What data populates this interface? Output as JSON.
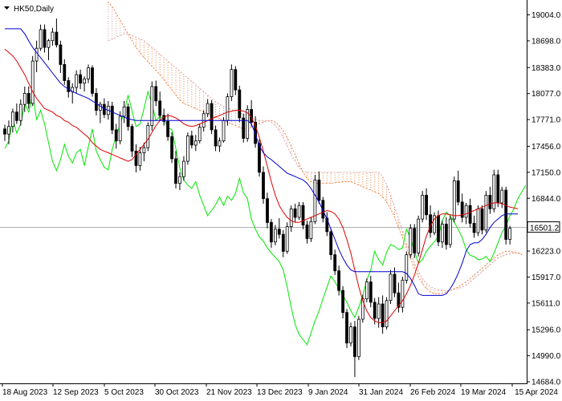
{
  "header": {
    "symbol_label": "HK50,Daily"
  },
  "colors": {
    "bull_candle": "#000000",
    "bear_candle": "#000000",
    "chikou": "#00e600",
    "tenkan": "#e00000",
    "kijun": "#0000d0",
    "cloud_bull_edge": "#d9a0a0",
    "cloud_bear_edge": "#f08040",
    "current_line": "#808080"
  },
  "chart_data": {
    "type": "candlestick",
    "indicator": "Ichimoku",
    "ylim": [
      14684,
      19160
    ],
    "y_ticks": [
      "19004.0",
      "18698.0",
      "18383.0",
      "18077.0",
      "17771.0",
      "17456.0",
      "17150.0",
      "16844.0",
      "16223.0",
      "15917.0",
      "15611.0",
      "15296.0",
      "14990.0",
      "14684.0"
    ],
    "x_ticks": [
      "18 Aug 2023",
      "12 Sep 2023",
      "5 Oct 2023",
      "30 Oct 2023",
      "21 Nov 2023",
      "13 Dec 2023",
      "9 Jan 2024",
      "31 Jan 2024",
      "26 Feb 2024",
      "19 Mar 2024",
      "15 Apr 2024"
    ],
    "current_price": "16501.2",
    "candles": [
      [
        17660,
        17710,
        17520,
        17600
      ],
      [
        17600,
        17760,
        17480,
        17690
      ],
      [
        17690,
        17900,
        17620,
        17860
      ],
      [
        17860,
        17960,
        17720,
        17760
      ],
      [
        17760,
        18010,
        17700,
        17950
      ],
      [
        17950,
        18160,
        17860,
        18080
      ],
      [
        18080,
        18160,
        17900,
        17960
      ],
      [
        17960,
        18520,
        17930,
        18460
      ],
      [
        18460,
        18700,
        18330,
        18610
      ],
      [
        18610,
        18890,
        18580,
        18830
      ],
      [
        18830,
        18890,
        18560,
        18620
      ],
      [
        18620,
        18720,
        18470,
        18700
      ],
      [
        18700,
        18850,
        18640,
        18800
      ],
      [
        18800,
        18960,
        18620,
        18650
      ],
      [
        18650,
        18700,
        18320,
        18420
      ],
      [
        18420,
        18480,
        18180,
        18230
      ],
      [
        18230,
        18270,
        18030,
        18100
      ],
      [
        18100,
        18200,
        17960,
        18150
      ],
      [
        18150,
        18350,
        18080,
        18300
      ],
      [
        18300,
        18360,
        18130,
        18200
      ],
      [
        18200,
        18280,
        18100,
        18250
      ],
      [
        18250,
        18420,
        18200,
        18380
      ],
      [
        18380,
        18410,
        18040,
        18080
      ],
      [
        18080,
        18140,
        17820,
        17880
      ],
      [
        17880,
        17980,
        17730,
        17950
      ],
      [
        17950,
        18020,
        17790,
        17830
      ],
      [
        17830,
        17990,
        17770,
        17930
      ],
      [
        17930,
        17980,
        17600,
        17650
      ],
      [
        17650,
        17720,
        17430,
        17520
      ],
      [
        17520,
        17870,
        17480,
        17810
      ],
      [
        17810,
        17990,
        17730,
        17920
      ],
      [
        17920,
        17960,
        17640,
        17690
      ],
      [
        17690,
        17720,
        17330,
        17400
      ],
      [
        17400,
        17480,
        17150,
        17230
      ],
      [
        17230,
        17450,
        17170,
        17380
      ],
      [
        17380,
        17500,
        17280,
        17440
      ],
      [
        17440,
        17740,
        17400,
        17700
      ],
      [
        17700,
        18220,
        17640,
        18160
      ],
      [
        18160,
        18230,
        17930,
        17990
      ],
      [
        17990,
        18100,
        17760,
        17820
      ],
      [
        17820,
        17900,
        17700,
        17750
      ],
      [
        17750,
        17840,
        17520,
        17570
      ],
      [
        17570,
        17620,
        17260,
        17310
      ],
      [
        17310,
        17400,
        16960,
        17020
      ],
      [
        17020,
        17150,
        16940,
        17100
      ],
      [
        17100,
        17340,
        17050,
        17280
      ],
      [
        17280,
        17620,
        17240,
        17580
      ],
      [
        17580,
        17640,
        17430,
        17470
      ],
      [
        17470,
        17590,
        17400,
        17520
      ],
      [
        17520,
        17720,
        17490,
        17680
      ],
      [
        17680,
        17880,
        17630,
        17840
      ],
      [
        17840,
        18010,
        17800,
        17960
      ],
      [
        17960,
        18000,
        17600,
        17650
      ],
      [
        17650,
        17700,
        17400,
        17460
      ],
      [
        17460,
        17560,
        17390,
        17520
      ],
      [
        17520,
        17800,
        17500,
        17760
      ],
      [
        17760,
        18080,
        17700,
        18040
      ],
      [
        18040,
        18420,
        17990,
        18360
      ],
      [
        18360,
        18400,
        18060,
        18120
      ],
      [
        18120,
        18170,
        17740,
        17790
      ],
      [
        17790,
        17840,
        17500,
        17550
      ],
      [
        17550,
        17940,
        17510,
        17890
      ],
      [
        17890,
        18000,
        17690,
        17740
      ],
      [
        17740,
        17810,
        17440,
        17490
      ],
      [
        17490,
        17540,
        17100,
        17150
      ],
      [
        17150,
        17220,
        16780,
        16840
      ],
      [
        16840,
        16910,
        16490,
        16560
      ],
      [
        16560,
        16600,
        16260,
        16330
      ],
      [
        16330,
        16530,
        16290,
        16480
      ],
      [
        16480,
        16610,
        16370,
        16420
      ],
      [
        16420,
        16470,
        16150,
        16220
      ],
      [
        16220,
        16560,
        16190,
        16510
      ],
      [
        16510,
        16760,
        16450,
        16720
      ],
      [
        16720,
        16780,
        16560,
        16620
      ],
      [
        16620,
        16800,
        16590,
        16760
      ],
      [
        16760,
        16800,
        16480,
        16530
      ],
      [
        16530,
        16580,
        16310,
        16370
      ],
      [
        16370,
        16620,
        16330,
        16570
      ],
      [
        16570,
        17120,
        16540,
        17060
      ],
      [
        17060,
        17160,
        16780,
        16820
      ],
      [
        16820,
        16860,
        16560,
        16610
      ],
      [
        16610,
        16680,
        16400,
        16450
      ],
      [
        16450,
        16490,
        16120,
        16180
      ],
      [
        16180,
        16240,
        15940,
        15990
      ],
      [
        15990,
        16050,
        15700,
        15760
      ],
      [
        15760,
        15810,
        15430,
        15500
      ],
      [
        15500,
        15540,
        15080,
        15140
      ],
      [
        15140,
        15380,
        15100,
        15330
      ],
      [
        15330,
        15400,
        14740,
        14980
      ],
      [
        14980,
        15460,
        14940,
        15420
      ],
      [
        15420,
        15710,
        15380,
        15660
      ],
      [
        15660,
        15900,
        15620,
        15860
      ],
      [
        15860,
        15930,
        15560,
        15620
      ],
      [
        15620,
        15670,
        15360,
        15430
      ],
      [
        15430,
        15680,
        15320,
        15600
      ],
      [
        15600,
        15700,
        15250,
        15330
      ],
      [
        15330,
        15680,
        15300,
        15640
      ],
      [
        15640,
        16000,
        15600,
        15950
      ],
      [
        15950,
        16030,
        15680,
        15730
      ],
      [
        15730,
        15850,
        15500,
        15560
      ],
      [
        15560,
        15920,
        15500,
        15880
      ],
      [
        15880,
        16220,
        15840,
        16180
      ],
      [
        16180,
        16540,
        16140,
        16490
      ],
      [
        16490,
        16540,
        16140,
        16200
      ],
      [
        16200,
        16640,
        16160,
        16600
      ],
      [
        16600,
        16930,
        16560,
        16880
      ],
      [
        16880,
        16960,
        16590,
        16650
      ],
      [
        16650,
        16760,
        16380,
        16440
      ],
      [
        16440,
        16680,
        16410,
        16640
      ],
      [
        16640,
        16700,
        16280,
        16330
      ],
      [
        16330,
        16580,
        16260,
        16540
      ],
      [
        16540,
        16620,
        16240,
        16300
      ],
      [
        16300,
        16640,
        16260,
        16600
      ],
      [
        16600,
        17100,
        16560,
        17050
      ],
      [
        17050,
        17170,
        16760,
        16800
      ],
      [
        16800,
        16900,
        16560,
        16620
      ],
      [
        16620,
        16790,
        16540,
        16760
      ],
      [
        16760,
        16840,
        16500,
        16550
      ],
      [
        16550,
        16640,
        16380,
        16440
      ],
      [
        16440,
        16760,
        16400,
        16720
      ],
      [
        16720,
        16760,
        16420,
        16470
      ],
      [
        16470,
        16930,
        16440,
        16880
      ],
      [
        16880,
        16980,
        16660,
        16720
      ],
      [
        16720,
        17180,
        16680,
        17120
      ],
      [
        17120,
        17180,
        16740,
        16790
      ],
      [
        16790,
        16980,
        16730,
        16940
      ],
      [
        16940,
        16980,
        16300,
        16360
      ],
      [
        16360,
        16520,
        16300,
        16490
      ]
    ],
    "tenkan": [
      18600,
      18560,
      18520,
      18460,
      18380,
      18300,
      18200,
      18100,
      18020,
      17960,
      17900,
      17880,
      17860,
      17820,
      17800,
      17760,
      17740,
      17700,
      17680,
      17640,
      17600,
      17560,
      17500,
      17460,
      17420,
      17400,
      17380,
      17360,
      17340,
      17320,
      17300,
      17280,
      17300,
      17360,
      17420,
      17480,
      17540,
      17620,
      17700,
      17760,
      17800,
      17820,
      17810,
      17790,
      17760,
      17720,
      17700,
      17690,
      17700,
      17720,
      17740,
      17760,
      17780,
      17800,
      17820,
      17840,
      17860,
      17870,
      17880,
      17880,
      17870,
      17850,
      17800,
      17700,
      17560,
      17400,
      17220,
      17040,
      16880,
      16760,
      16680,
      16620,
      16580,
      16560,
      16560,
      16580,
      16600,
      16620,
      16640,
      16660,
      16680,
      16700,
      16690,
      16660,
      16600,
      16500,
      16360,
      16200,
      16000,
      15800,
      15640,
      15520,
      15440,
      15400,
      15380,
      15380,
      15400,
      15460,
      15520,
      15580,
      15640,
      15720,
      15820,
      15940,
      16080,
      16240,
      16400,
      16520,
      16600,
      16640,
      16660,
      16660,
      16650,
      16640,
      16640,
      16650,
      16660,
      16680,
      16700,
      16720,
      16740,
      16760,
      16780,
      16790,
      16790,
      16780,
      16760,
      16740,
      16730,
      16720
    ],
    "kijun": [
      18840,
      18840,
      18840,
      18840,
      18840,
      18780,
      18700,
      18620,
      18560,
      18500,
      18440,
      18380,
      18320,
      18260,
      18200,
      18160,
      18130,
      18100,
      18080,
      18060,
      18040,
      18020,
      17990,
      17960,
      17930,
      17900,
      17880,
      17860,
      17840,
      17820,
      17800,
      17780,
      17770,
      17760,
      17760,
      17760,
      17760,
      17760,
      17760,
      17760,
      17760,
      17760,
      17760,
      17760,
      17760,
      17760,
      17760,
      17760,
      17760,
      17760,
      17760,
      17760,
      17760,
      17760,
      17760,
      17760,
      17760,
      17760,
      17760,
      17760,
      17760,
      17760,
      17720,
      17600,
      17460,
      17380,
      17330,
      17300,
      17260,
      17220,
      17180,
      17140,
      17120,
      17100,
      17080,
      17060,
      17020,
      16960,
      16880,
      16800,
      16700,
      16600,
      16480,
      16360,
      16240,
      16140,
      16060,
      16000,
      15980,
      15980,
      15980,
      15980,
      15980,
      15980,
      15980,
      15980,
      15980,
      15980,
      15980,
      15980,
      15980,
      15960,
      15900,
      15820,
      15720,
      15700,
      15700,
      15700,
      15700,
      15700,
      15700,
      15720,
      15780,
      15860,
      15960,
      16080,
      16220,
      16300,
      16320,
      16320,
      16360,
      16420,
      16500,
      16560,
      16600,
      16640,
      16660,
      16660,
      16660,
      16660
    ],
    "span_a": [
      null,
      null,
      null,
      null,
      null,
      null,
      null,
      null,
      null,
      null,
      null,
      null,
      null,
      null,
      null,
      null,
      null,
      null,
      null,
      null,
      null,
      null,
      null,
      null,
      null,
      null,
      19160,
      19100,
      19020,
      18940,
      18860,
      18780,
      18700,
      18620,
      18560,
      18500,
      18450,
      18400,
      18350,
      18300,
      18240,
      18180,
      18120,
      18060,
      18000,
      17960,
      17940,
      17920,
      17900,
      17880,
      17860,
      17840,
      17820,
      17800,
      17780,
      17760,
      17740,
      17720,
      17700,
      17680,
      17660,
      17660,
      17680,
      17700,
      17720,
      17740,
      17760,
      17760,
      17740,
      17700,
      17640,
      17560,
      17460,
      17360,
      17250,
      17150,
      17080,
      17040,
      17020,
      17020,
      17020,
      17020,
      17020,
      17030,
      17030,
      17040,
      17040,
      17040,
      17020,
      17000,
      16980,
      16960,
      16940,
      16920,
      16900,
      16860,
      16800,
      16720,
      16620,
      16500,
      16380,
      16260,
      16140,
      16020,
      15920,
      15840,
      15780,
      15740,
      15720,
      15720,
      15720,
      15740,
      15760,
      15780,
      15800,
      15830,
      15860,
      15900,
      15940,
      15980,
      16020,
      16060,
      16100,
      16140,
      16180,
      16200,
      16220,
      16220,
      16210,
      16200,
      16180
    ],
    "span_b": [
      null,
      null,
      null,
      null,
      null,
      null,
      null,
      null,
      null,
      null,
      null,
      null,
      null,
      null,
      null,
      null,
      null,
      null,
      null,
      null,
      null,
      null,
      null,
      null,
      null,
      null,
      18700,
      18720,
      18740,
      18760,
      18780,
      18780,
      18760,
      18740,
      18720,
      18700,
      18660,
      18620,
      18580,
      18540,
      18500,
      18460,
      18420,
      18380,
      18340,
      18300,
      18260,
      18220,
      18180,
      18140,
      18100,
      18060,
      18020,
      17980,
      17950,
      17930,
      17910,
      17890,
      17870,
      17850,
      17830,
      17810,
      17790,
      17770,
      17760,
      17760,
      17760,
      17740,
      17700,
      17640,
      17560,
      17460,
      17360,
      17280,
      17200,
      17160,
      17150,
      17150,
      17150,
      17150,
      17150,
      17150,
      17150,
      17150,
      17150,
      17150,
      17150,
      17150,
      17150,
      17150,
      17150,
      17150,
      17150,
      17150,
      17150,
      17100,
      17000,
      16880,
      16740,
      16600,
      16460,
      16320,
      16200,
      16080,
      15980,
      15900,
      15840,
      15800,
      15780,
      15770,
      15760,
      15760,
      15760,
      15770,
      15780,
      15800,
      15820,
      15860,
      15900,
      15940,
      15980,
      16020,
      16060,
      16100,
      16140,
      16160,
      16180,
      16190,
      16200,
      16200,
      16200
    ],
    "chikou": [
      17430,
      17520,
      17770,
      17610,
      17720,
      17960,
      17860,
      18060,
      17770,
      17880,
      17720,
      17500,
      17280,
      17170,
      17300,
      17480,
      17340,
      17260,
      17380,
      17420,
      17230,
      17450,
      17660,
      17400,
      17300,
      17210,
      17180,
      17420,
      17580,
      17720,
      17850,
      18060,
      17870,
      17690,
      17720,
      17900,
      18100,
      17960,
      17760,
      17810,
      17770,
      17680,
      17650,
      17430,
      17200,
      17060,
      17000,
      16960,
      17040,
      16880,
      16760,
      16640,
      16700,
      16770,
      16860,
      16760,
      16870,
      16820,
      16900,
      17080,
      16910,
      16840,
      16600,
      16480,
      16390,
      16340,
      16260,
      16200,
      16150,
      16100,
      16000,
      15800,
      15560,
      15360,
      15240,
      15180,
      15120,
      15260,
      15400,
      15520,
      15660,
      15800,
      15930,
      15860,
      15780,
      15700,
      15620,
      15520,
      15440,
      15560,
      15700,
      15880,
      16000,
      16220,
      16120,
      16060,
      16210,
      16300,
      16280,
      16240,
      16260,
      16480,
      16380,
      16220,
      16080,
      16120,
      16220,
      16280,
      16330,
      16400,
      16580,
      16680,
      16640,
      16560,
      16480,
      16380,
      16240,
      16170,
      16160,
      16120,
      16130,
      16160,
      16100,
      16200,
      16320,
      16440,
      16520,
      16640,
      16720,
      16840,
      16920,
      17000,
      17080,
      17120,
      17060,
      16960,
      16760,
      16700,
      16740,
      16660,
      16620,
      16720,
      16660,
      16820,
      16860,
      16920,
      16880,
      16820
    ]
  }
}
